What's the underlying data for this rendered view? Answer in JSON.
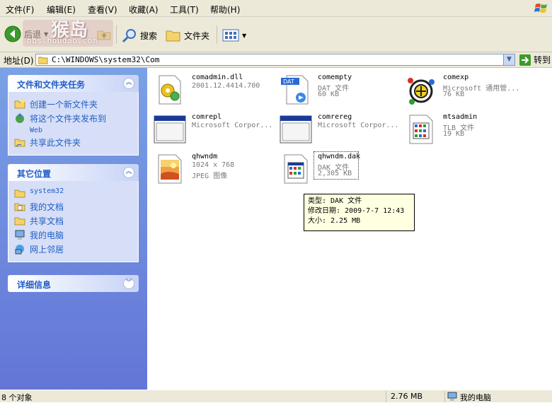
{
  "menu": [
    "文件(F)",
    "编辑(E)",
    "查看(V)",
    "收藏(A)",
    "工具(T)",
    "帮助(H)"
  ],
  "toolbar": {
    "back": "后退",
    "search": "搜索",
    "folders": "文件夹"
  },
  "watermark": {
    "text": "bbs.houdao.com",
    "big": "猴岛"
  },
  "address": {
    "label": "地址(D)",
    "path": "C:\\WINDOWS\\system32\\Com",
    "go": "转到"
  },
  "panels": {
    "tasks": {
      "title": "文件和文件夹任务",
      "items": [
        "创建一个新文件夹",
        "将这个文件夹发布到",
        "Web",
        "共享此文件夹"
      ]
    },
    "places": {
      "title": "其它位置",
      "items": [
        "system32",
        "我的文档",
        "共享文档",
        "我的电脑",
        "网上邻居"
      ]
    },
    "details": {
      "title": "详细信息"
    }
  },
  "files": [
    {
      "name": "comadmin.dll",
      "info1": "2001.12.4414.700",
      "info2": "",
      "icon": "dll-gear-icon"
    },
    {
      "name": "comempty",
      "info1": "DAT 文件",
      "info2": "60 KB",
      "icon": "dat-file-icon"
    },
    {
      "name": "comexp",
      "info1": "Microsoft 通用管...",
      "info2": "76 KB",
      "icon": "mmc-console-icon"
    },
    {
      "name": "comrepl",
      "info1": "Microsoft Corpor...",
      "info2": "",
      "icon": "window-app-icon"
    },
    {
      "name": "comrereg",
      "info1": "Microsoft Corpor...",
      "info2": "",
      "icon": "window-app-icon"
    },
    {
      "name": "mtsadmin",
      "info1": "TLB 文件",
      "info2": "19 KB",
      "icon": "tlb-file-icon"
    },
    {
      "name": "qhwndm",
      "info1": "1024 x 768",
      "info2": "JPEG 图像",
      "icon": "jpeg-image-icon"
    },
    {
      "name": "qhwndm.dak",
      "info1": "DAK 文件",
      "info2": "2,305 KB",
      "icon": "dak-file-icon"
    }
  ],
  "tooltip": {
    "type": "类型: DAK 文件",
    "modified": "修改日期: 2009-7-7 12:43",
    "size": "大小: 2.25 MB"
  },
  "status": {
    "count": "8 个对象",
    "size": "2.76 MB",
    "location": "我的电脑"
  }
}
